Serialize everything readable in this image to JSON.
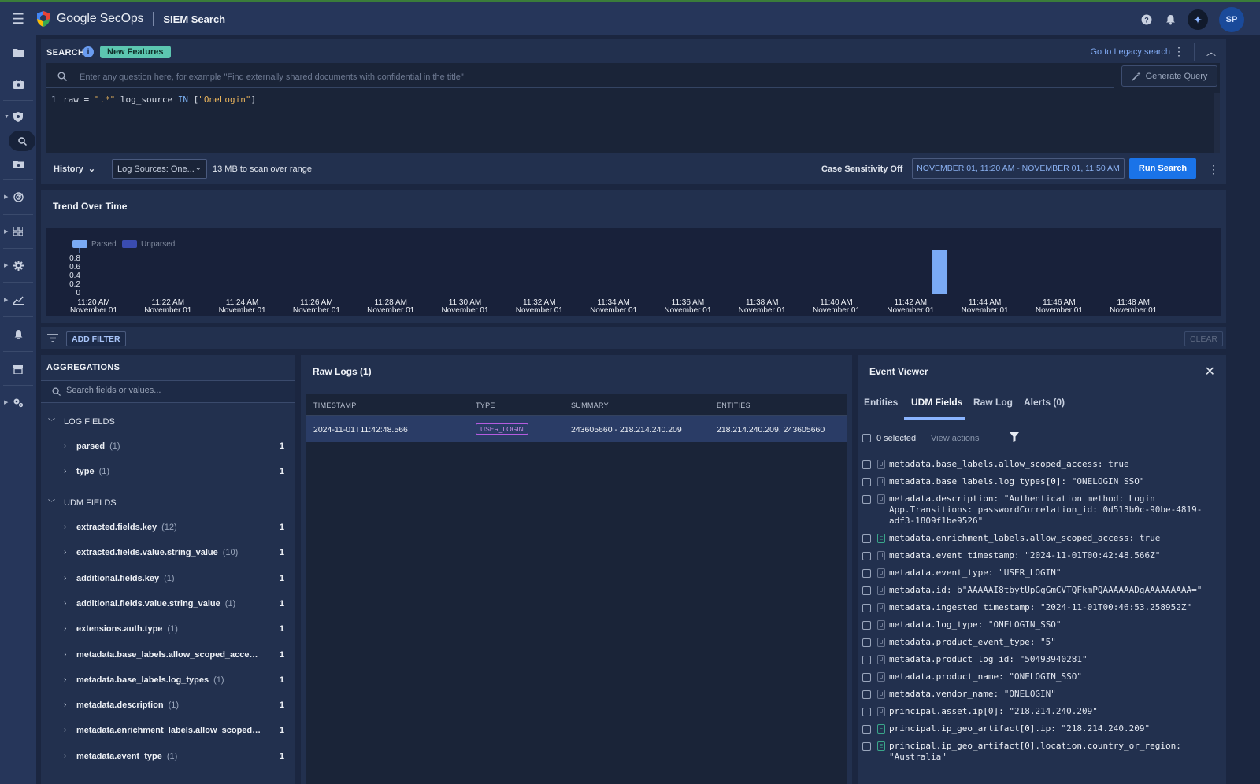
{
  "topbar": {
    "brand": "Google SecOps",
    "page_name": "SIEM Search",
    "avatar_initials": "SP"
  },
  "search": {
    "title": "SEARCH",
    "new_features_label": "New Features",
    "legacy_link": "Go to Legacy search",
    "ask_placeholder": "Enter any question here, for example \"Find externally shared documents with confidential in the title\"",
    "generate_query_label": "Generate Query",
    "line_number": "1",
    "query_parts": {
      "p1": "raw = ",
      "p2": "\".*\"",
      "p3": " log_source ",
      "p4": "IN",
      "p5": " [",
      "p6": "\"OneLogin\"",
      "p7": "]"
    },
    "history_label": "History",
    "log_sources_label": "Log Sources: One...",
    "scan_text": "13 MB to scan over range",
    "case_sensitivity": "Case Sensitivity Off",
    "date_range": "NOVEMBER 01, 11:20 AM - NOVEMBER 01, 11:50 AM",
    "run_label": "Run Search"
  },
  "trend": {
    "title": "Trend Over Time"
  },
  "chart_data": {
    "type": "bar",
    "title": "Trend Over Time",
    "series": [
      {
        "name": "Parsed",
        "color": "#7aaaf4",
        "points": [
          {
            "x": "11:42:48",
            "y": 1
          }
        ]
      },
      {
        "name": "Unparsed",
        "color": "#3a4cb0",
        "points": []
      }
    ],
    "y_ticks": [
      "0.8",
      "0.6",
      "0.4",
      "0.2",
      "0"
    ],
    "x_ticks": [
      {
        "time": "11:20 AM",
        "date": "November 01"
      },
      {
        "time": "11:22 AM",
        "date": "November 01"
      },
      {
        "time": "11:24 AM",
        "date": "November 01"
      },
      {
        "time": "11:26 AM",
        "date": "November 01"
      },
      {
        "time": "11:28 AM",
        "date": "November 01"
      },
      {
        "time": "11:30 AM",
        "date": "November 01"
      },
      {
        "time": "11:32 AM",
        "date": "November 01"
      },
      {
        "time": "11:34 AM",
        "date": "November 01"
      },
      {
        "time": "11:36 AM",
        "date": "November 01"
      },
      {
        "time": "11:38 AM",
        "date": "November 01"
      },
      {
        "time": "11:40 AM",
        "date": "November 01"
      },
      {
        "time": "11:42 AM",
        "date": "November 01"
      },
      {
        "time": "11:44 AM",
        "date": "November 01"
      },
      {
        "time": "11:46 AM",
        "date": "November 01"
      },
      {
        "time": "11:48 AM",
        "date": "November 01"
      }
    ],
    "ylim": [
      0,
      1
    ],
    "legend_position": "top-left",
    "grid": false
  },
  "filter_bar": {
    "add_filter_label": "ADD FILTER",
    "clear_label": "CLEAR"
  },
  "aggregations": {
    "title": "AGGREGATIONS",
    "search_placeholder": "Search fields or values...",
    "log_fields_label": "LOG FIELDS",
    "udm_fields_label": "UDM FIELDS",
    "log_fields": [
      {
        "name": "parsed",
        "count": "(1)",
        "total": "1"
      },
      {
        "name": "type",
        "count": "(1)",
        "total": "1"
      }
    ],
    "udm_fields": [
      {
        "name": "extracted.fields.key",
        "count": "(12)",
        "total": "1"
      },
      {
        "name": "extracted.fields.value.string_value",
        "count": "(10)",
        "total": "1"
      },
      {
        "name": "additional.fields.key",
        "count": "(1)",
        "total": "1"
      },
      {
        "name": "additional.fields.value.string_value",
        "count": "(1)",
        "total": "1"
      },
      {
        "name": "extensions.auth.type",
        "count": "(1)",
        "total": "1"
      },
      {
        "name": "metadata.base_labels.allow_scoped_access",
        "count": "(1)",
        "total": "1"
      },
      {
        "name": "metadata.base_labels.log_types",
        "count": "(1)",
        "total": "1"
      },
      {
        "name": "metadata.description",
        "count": "(1)",
        "total": "1"
      },
      {
        "name": "metadata.enrichment_labels.allow_scoped_...",
        "count": "(1)",
        "total": "1"
      },
      {
        "name": "metadata.event_type",
        "count": "(1)",
        "total": "1"
      }
    ]
  },
  "raw_logs": {
    "title": "Raw Logs (1)",
    "columns": [
      "TIMESTAMP",
      "TYPE",
      "SUMMARY",
      "ENTITIES"
    ],
    "rows": [
      {
        "timestamp": "2024-11-01T11:42:48.566",
        "type": "USER_LOGIN",
        "summary": "243605660 - 218.214.240.209",
        "entities": "218.214.240.209, 243605660"
      }
    ]
  },
  "event_viewer": {
    "title": "Event Viewer",
    "tabs": [
      "Entities",
      "UDM Fields",
      "Raw Log",
      "Alerts (0)"
    ],
    "selected_text": "0 selected",
    "view_actions": "View actions",
    "fields": [
      {
        "tag": "U",
        "key": "metadata.base_labels.allow_scoped_access:",
        "value": " true"
      },
      {
        "tag": "U",
        "key": "metadata.base_labels.log_types[0]:",
        "value": " \"ONELOGIN_SSO\""
      },
      {
        "tag": "U",
        "key": "metadata.description:",
        "value": " \"Authentication method: Login\nApp.Transitions: passwordCorrelation_id: 0d513b0c-90be-4819-\nadf3-1809f1be9526\""
      },
      {
        "tag": "E",
        "key": "metadata.enrichment_labels.allow_scoped_access:",
        "value": " true"
      },
      {
        "tag": "U",
        "key": "metadata.event_timestamp:",
        "value": " \"2024-11-01T00:42:48.566Z\""
      },
      {
        "tag": "U",
        "key": "metadata.event_type:",
        "value": " \"USER_LOGIN\""
      },
      {
        "tag": "U",
        "key": "metadata.id:",
        "value": " b\"AAAAAI8tbytUpGgGmCVTQFkmPQAAAAAADgAAAAAAAAA=\""
      },
      {
        "tag": "U",
        "key": "metadata.ingested_timestamp:",
        "value": " \"2024-11-01T00:46:53.258952Z\""
      },
      {
        "tag": "U",
        "key": "metadata.log_type:",
        "value": " \"ONELOGIN_SSO\""
      },
      {
        "tag": "U",
        "key": "metadata.product_event_type:",
        "value": " \"5\""
      },
      {
        "tag": "U",
        "key": "metadata.product_log_id:",
        "value": " \"50493940281\""
      },
      {
        "tag": "U",
        "key": "metadata.product_name:",
        "value": " \"ONELOGIN_SSO\""
      },
      {
        "tag": "U",
        "key": "metadata.vendor_name:",
        "value": " \"ONELOGIN\""
      },
      {
        "tag": "U",
        "key": "principal.asset.ip[0]:",
        "value": " \"218.214.240.209\""
      },
      {
        "tag": "E",
        "key": "principal.ip_geo_artifact[0].ip:",
        "value": " \"218.214.240.209\""
      },
      {
        "tag": "E",
        "key": "principal.ip_geo_artifact[0].location.country_or_region:",
        "value": "\n\"Australia\""
      }
    ]
  }
}
